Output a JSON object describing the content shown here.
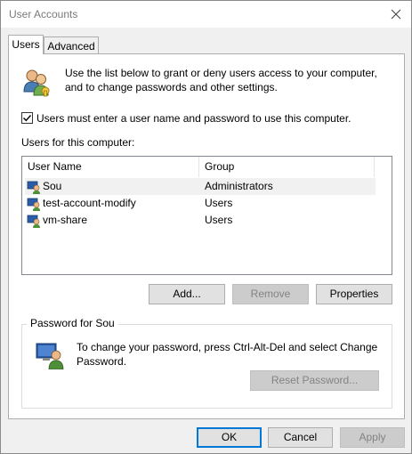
{
  "window": {
    "title": "User Accounts"
  },
  "tabs": [
    {
      "label": "Users",
      "active": true
    },
    {
      "label": "Advanced",
      "active": false
    }
  ],
  "intro": {
    "line1": "Use the list below to grant or deny users access to your computer,",
    "line2": "and to change passwords and other settings.",
    "icon": "users-icon"
  },
  "must_login": {
    "label": "Users must enter a user name and password to use this computer.",
    "checked": true
  },
  "users_label": "Users for this computer:",
  "table": {
    "columns": [
      "User Name",
      "Group"
    ],
    "rows": [
      {
        "name": "Sou",
        "group": "Administrators",
        "selected": true
      },
      {
        "name": "test-account-modify",
        "group": "Users",
        "selected": false
      },
      {
        "name": "vm-share",
        "group": "Users",
        "selected": false
      }
    ]
  },
  "list_buttons": {
    "add": "Add...",
    "remove": "Remove",
    "properties": "Properties"
  },
  "password_group": {
    "label": "Password for Sou",
    "line1": "To change your password, press Ctrl-Alt-Del and select Change",
    "line2": "Password.",
    "reset": "Reset Password..."
  },
  "footer": {
    "ok": "OK",
    "cancel": "Cancel",
    "apply": "Apply"
  },
  "colors": {
    "accent": "#0078d7",
    "selected_row": "#f1f1f1",
    "disabled_text": "#838383"
  }
}
